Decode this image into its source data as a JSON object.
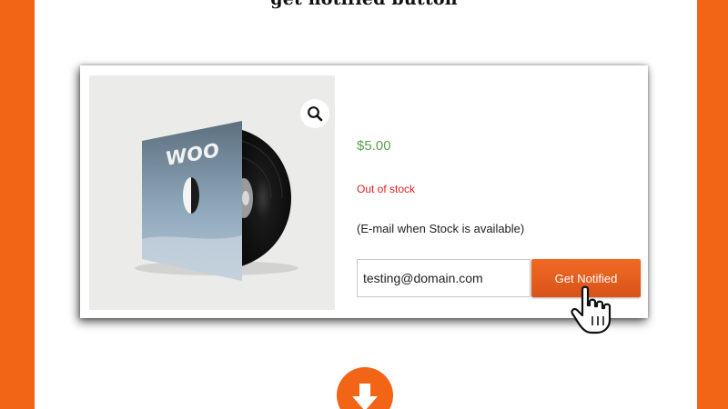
{
  "heading": {
    "text": "get notified button"
  },
  "product": {
    "price": "$5.00",
    "stock_status": "Out of stock",
    "notice": "(E-mail when Stock is available)",
    "image_text": "WOO",
    "zoom_icon": "magnifier-icon"
  },
  "notify_form": {
    "email_value": "testing@domain.com",
    "button_label": "Get Notified"
  },
  "colors": {
    "background": "#f26516",
    "button": "#e2591c",
    "price": "#5aa24e",
    "stock": "#e02020"
  },
  "icons": {
    "cursor": "hand-pointer-icon",
    "scroll": "arrow-down-icon"
  }
}
